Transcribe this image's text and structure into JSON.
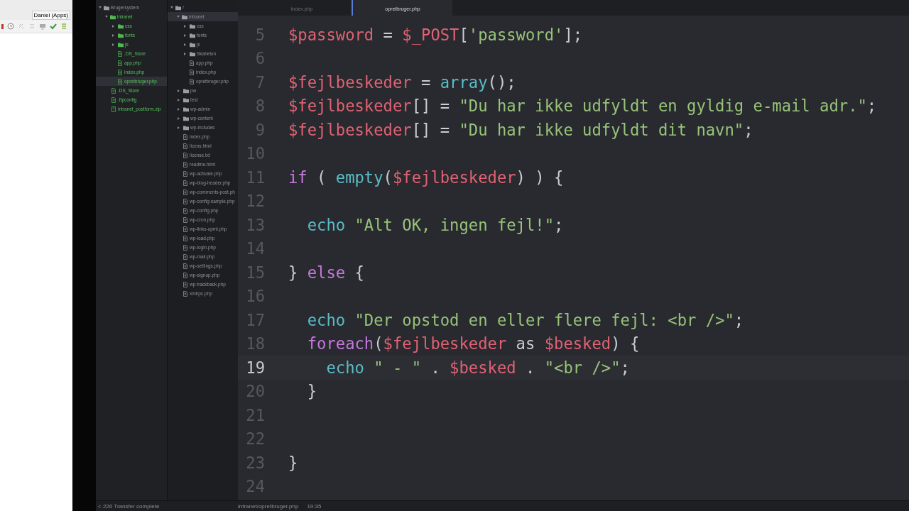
{
  "browser_window": {
    "tooltip": "Daniel (Apps)"
  },
  "project_tree": [
    {
      "name": "Brugersystem",
      "kind": "folder",
      "expanded": true,
      "modified": false,
      "selected": false,
      "children": [
        {
          "name": "intranet",
          "kind": "folder",
          "expanded": true,
          "modified": true,
          "selected": false,
          "children": [
            {
              "name": "css",
              "kind": "folder",
              "expanded": false,
              "modified": true,
              "selected": false
            },
            {
              "name": "fonts",
              "kind": "folder",
              "expanded": false,
              "modified": true,
              "selected": false
            },
            {
              "name": "js",
              "kind": "folder",
              "expanded": false,
              "modified": true,
              "selected": false
            },
            {
              "name": ".DS_Store",
              "kind": "file",
              "modified": true,
              "selected": false
            },
            {
              "name": "app.php",
              "kind": "file",
              "modified": true,
              "selected": false
            },
            {
              "name": "index.php",
              "kind": "file",
              "modified": true,
              "selected": false
            },
            {
              "name": "opretbruger.php",
              "kind": "file",
              "modified": true,
              "selected": true
            }
          ]
        },
        {
          "name": ".DS_Store",
          "kind": "file",
          "modified": true,
          "selected": false
        },
        {
          "name": ".ftpconfig",
          "kind": "file",
          "modified": true,
          "selected": false
        },
        {
          "name": "intranet_postform.zip",
          "kind": "zip",
          "modified": true,
          "selected": false
        }
      ]
    }
  ],
  "remote_tree": [
    {
      "name": "/",
      "kind": "folder",
      "expanded": true,
      "modified": false,
      "selected": false,
      "children": [
        {
          "name": "intranet",
          "kind": "folder",
          "expanded": true,
          "modified": false,
          "selected": true,
          "children": [
            {
              "name": "css",
              "kind": "folder",
              "expanded": false,
              "modified": false,
              "selected": false
            },
            {
              "name": "fonts",
              "kind": "folder",
              "expanded": false,
              "modified": false,
              "selected": false
            },
            {
              "name": "js",
              "kind": "folder",
              "expanded": false,
              "modified": false,
              "selected": false
            },
            {
              "name": "Skabelon",
              "kind": "folder",
              "expanded": false,
              "modified": false,
              "selected": false
            },
            {
              "name": "app.php",
              "kind": "file",
              "modified": false,
              "selected": false
            },
            {
              "name": "index.php",
              "kind": "file",
              "modified": false,
              "selected": false
            },
            {
              "name": "opretbruger.php",
              "kind": "file",
              "modified": false,
              "selected": false
            }
          ]
        },
        {
          "name": "pw",
          "kind": "folder",
          "expanded": false,
          "modified": false,
          "selected": false
        },
        {
          "name": "test",
          "kind": "folder",
          "expanded": false,
          "modified": false,
          "selected": false
        },
        {
          "name": "wp-admin",
          "kind": "folder",
          "expanded": false,
          "modified": false,
          "selected": false
        },
        {
          "name": "wp-content",
          "kind": "folder",
          "expanded": false,
          "modified": false,
          "selected": false
        },
        {
          "name": "wp-includes",
          "kind": "folder",
          "expanded": false,
          "modified": false,
          "selected": false
        },
        {
          "name": "index.php",
          "kind": "file",
          "modified": false,
          "selected": false
        },
        {
          "name": "licens.html",
          "kind": "file",
          "modified": false,
          "selected": false
        },
        {
          "name": "license.txt",
          "kind": "file",
          "modified": false,
          "selected": false
        },
        {
          "name": "readme.html",
          "kind": "file",
          "modified": false,
          "selected": false
        },
        {
          "name": "wp-activate.php",
          "kind": "file",
          "modified": false,
          "selected": false
        },
        {
          "name": "wp-blog-header.php",
          "kind": "file",
          "modified": false,
          "selected": false
        },
        {
          "name": "wp-comments-post.ph",
          "kind": "file",
          "modified": false,
          "selected": false
        },
        {
          "name": "wp-config-sample.php",
          "kind": "file",
          "modified": false,
          "selected": false
        },
        {
          "name": "wp-config.php",
          "kind": "file",
          "modified": false,
          "selected": false
        },
        {
          "name": "wp-cron.php",
          "kind": "file",
          "modified": false,
          "selected": false
        },
        {
          "name": "wp-links-opml.php",
          "kind": "file",
          "modified": false,
          "selected": false
        },
        {
          "name": "wp-load.php",
          "kind": "file",
          "modified": false,
          "selected": false
        },
        {
          "name": "wp-login.php",
          "kind": "file",
          "modified": false,
          "selected": false
        },
        {
          "name": "wp-mail.php",
          "kind": "file",
          "modified": false,
          "selected": false
        },
        {
          "name": "wp-settings.php",
          "kind": "file",
          "modified": false,
          "selected": false
        },
        {
          "name": "wp-signup.php",
          "kind": "file",
          "modified": false,
          "selected": false
        },
        {
          "name": "wp-trackback.php",
          "kind": "file",
          "modified": false,
          "selected": false
        },
        {
          "name": "xmlrpc.php",
          "kind": "file",
          "modified": false,
          "selected": false
        }
      ]
    }
  ],
  "tabs": [
    {
      "label": "index.php",
      "selected": false
    },
    {
      "label": "opretbruger.php",
      "selected": true
    }
  ],
  "code_lines": [
    {
      "number": "5",
      "current": false,
      "tokens": [
        {
          "text": "$password",
          "kind": "var"
        },
        {
          "text": " = ",
          "kind": "plain"
        },
        {
          "text": "$_POST",
          "kind": "var"
        },
        {
          "text": "[",
          "kind": "plain"
        },
        {
          "text": "'password'",
          "kind": "str"
        },
        {
          "text": "];",
          "kind": "plain"
        }
      ]
    },
    {
      "number": "6",
      "current": false
    },
    {
      "number": "7",
      "current": false,
      "tokens": [
        {
          "text": "$fejlbeskeder",
          "kind": "var"
        },
        {
          "text": " = ",
          "kind": "plain"
        },
        {
          "text": "array",
          "kind": "fn"
        },
        {
          "text": "();",
          "kind": "plain"
        }
      ]
    },
    {
      "number": "8",
      "current": false,
      "tokens": [
        {
          "text": "$fejlbeskeder",
          "kind": "var"
        },
        {
          "text": "[] = ",
          "kind": "plain"
        },
        {
          "text": "\"Du har ikke udfyldt en gyldig e-mail adr.\"",
          "kind": "str"
        },
        {
          "text": ";",
          "kind": "plain"
        }
      ]
    },
    {
      "number": "9",
      "current": false,
      "tokens": [
        {
          "text": "$fejlbeskeder",
          "kind": "var"
        },
        {
          "text": "[] = ",
          "kind": "plain"
        },
        {
          "text": "\"Du har ikke udfyldt dit navn\"",
          "kind": "str"
        },
        {
          "text": ";",
          "kind": "plain"
        }
      ]
    },
    {
      "number": "10",
      "current": false
    },
    {
      "number": "11",
      "current": false,
      "tokens": [
        {
          "text": "if",
          "kind": "kw"
        },
        {
          "text": " ( ",
          "kind": "plain"
        },
        {
          "text": "empty",
          "kind": "fn"
        },
        {
          "text": "(",
          "kind": "plain"
        },
        {
          "text": "$fejlbeskeder",
          "kind": "var"
        },
        {
          "text": ") ) {",
          "kind": "plain"
        }
      ]
    },
    {
      "number": "12",
      "current": false
    },
    {
      "number": "13",
      "current": false,
      "tokens": [
        {
          "text": "  echo",
          "kind": "fn"
        },
        {
          "text": " \"Alt OK, ingen fejl!\"",
          "kind": "str"
        },
        {
          "text": ";",
          "kind": "plain"
        }
      ]
    },
    {
      "number": "14",
      "current": false
    },
    {
      "number": "15",
      "current": false,
      "tokens": [
        {
          "text": "} ",
          "kind": "plain"
        },
        {
          "text": "else",
          "kind": "kw"
        },
        {
          "text": " {",
          "kind": "plain"
        }
      ]
    },
    {
      "number": "16",
      "current": false
    },
    {
      "number": "17",
      "current": false,
      "tokens": [
        {
          "text": "  echo",
          "kind": "fn"
        },
        {
          "text": " \"Der opstod en eller flere fejl: <br />\"",
          "kind": "str"
        },
        {
          "text": ";",
          "kind": "plain"
        }
      ]
    },
    {
      "number": "18",
      "current": false,
      "tokens": [
        {
          "text": "  foreach",
          "kind": "kw"
        },
        {
          "text": "(",
          "kind": "plain"
        },
        {
          "text": "$fejlbeskeder",
          "kind": "var"
        },
        {
          "text": " as ",
          "kind": "plain"
        },
        {
          "text": "$besked",
          "kind": "var"
        },
        {
          "text": ") {",
          "kind": "plain"
        }
      ]
    },
    {
      "number": "19",
      "current": true,
      "tokens": [
        {
          "text": "    echo",
          "kind": "fn"
        },
        {
          "text": " \" - \"",
          "kind": "str"
        },
        {
          "text": " . ",
          "kind": "plain"
        },
        {
          "text": "$besked",
          "kind": "var"
        },
        {
          "text": " . ",
          "kind": "plain"
        },
        {
          "text": "\"<br />\"",
          "kind": "str"
        },
        {
          "text": ";",
          "kind": "plain"
        }
      ]
    },
    {
      "number": "20",
      "current": false,
      "tokens": [
        {
          "text": "  }",
          "kind": "plain"
        }
      ]
    },
    {
      "number": "21",
      "current": false
    },
    {
      "number": "22",
      "current": false
    },
    {
      "number": "23",
      "current": false,
      "tokens": [
        {
          "text": "}",
          "kind": "plain"
        }
      ]
    },
    {
      "number": "24",
      "current": false
    }
  ],
  "status_bar": {
    "transfer": "< 226 Transfer complete",
    "file_path": "intranet/opretbruger.php",
    "cursor": "19:35"
  }
}
